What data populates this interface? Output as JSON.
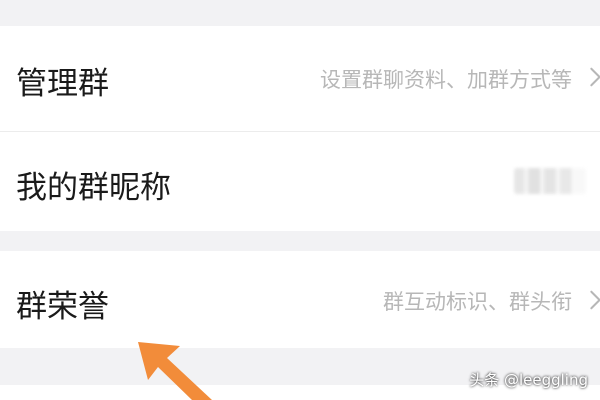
{
  "rows": {
    "manage": {
      "title": "管理群",
      "value": "设置群聊资料、加群方式等",
      "chevron": "chevron-right-icon"
    },
    "nickname": {
      "title": "我的群昵称",
      "value_blurred": true
    },
    "honor": {
      "title": "群荣誉",
      "value": "群互动标识、群头衔",
      "chevron": "chevron-right-icon"
    }
  },
  "watermark": "头条 @leeggling",
  "colors": {
    "background": "#f2f2f4",
    "row": "#ffffff",
    "title": "#1a1a1a",
    "secondary_text": "#b7b7b7",
    "arrow": "#f28c3a"
  }
}
